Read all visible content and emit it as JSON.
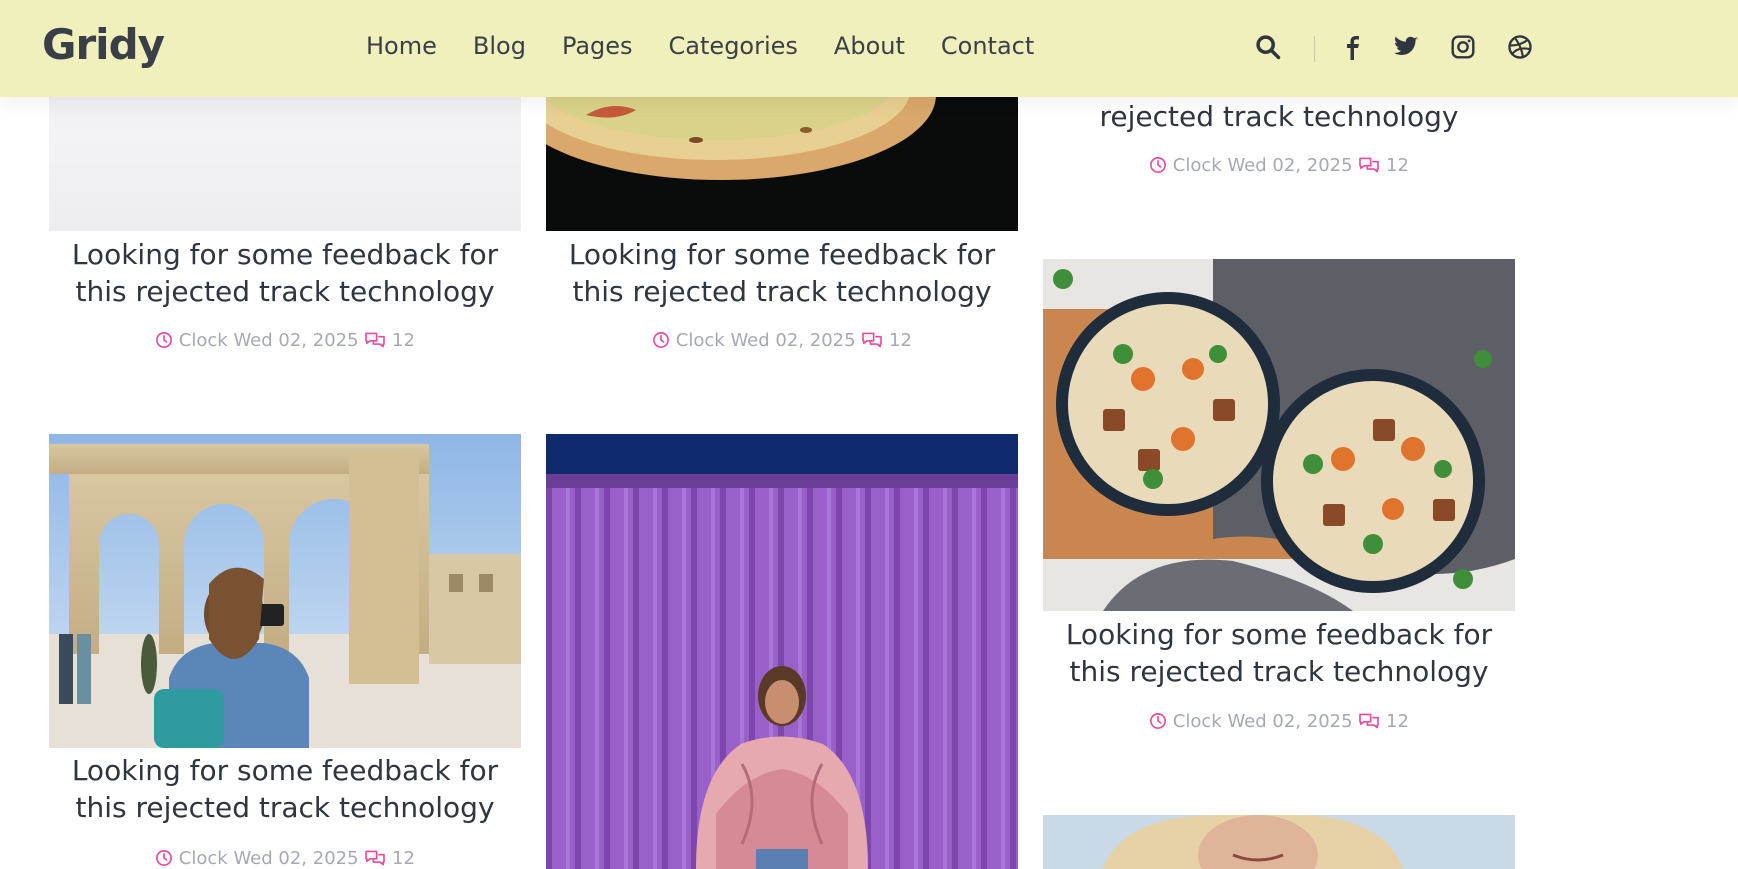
{
  "brand": {
    "name": "Gridy"
  },
  "nav": {
    "items": [
      "Home",
      "Blog",
      "Pages",
      "Categories",
      "About",
      "Contact"
    ]
  },
  "header_icons": [
    "search-icon",
    "facebook-icon",
    "twitter-icon",
    "instagram-icon",
    "dribbble-icon"
  ],
  "colors": {
    "header_bg": "#f0f0bd",
    "accent": "#e84aa0",
    "meta_text": "#a5a9b3",
    "title_text": "#2f3640"
  },
  "posts": [
    {
      "title": "Looking for some feedback for this rejected track technology",
      "clock_label": "Clock",
      "date": "Wed 02, 2025",
      "comments": "12",
      "image": "paper"
    },
    {
      "title": "Looking for some feedback for this rejected track technology",
      "clock_label": "Clock",
      "date": "Wed 02, 2025",
      "comments": "12",
      "image": "pizza"
    },
    {
      "title": "rejected track technology",
      "clock_label": "Clock",
      "date": "Wed 02, 2025",
      "comments": "12",
      "image": "none"
    },
    {
      "title": "Looking for some feedback for this rejected track technology",
      "clock_label": "Clock",
      "date": "Wed 02, 2025",
      "comments": "12",
      "image": "noodle-bowls"
    },
    {
      "title": "Looking for some feedback for this rejected track technology",
      "clock_label": "Clock",
      "date": "Wed 02, 2025",
      "comments": "12",
      "image": "arches-photographer"
    },
    {
      "title": "",
      "clock_label": "",
      "date": "",
      "comments": "",
      "image": "purple-wall-woman"
    },
    {
      "title": "",
      "clock_label": "",
      "date": "",
      "comments": "",
      "image": "blonde-portrait"
    }
  ]
}
